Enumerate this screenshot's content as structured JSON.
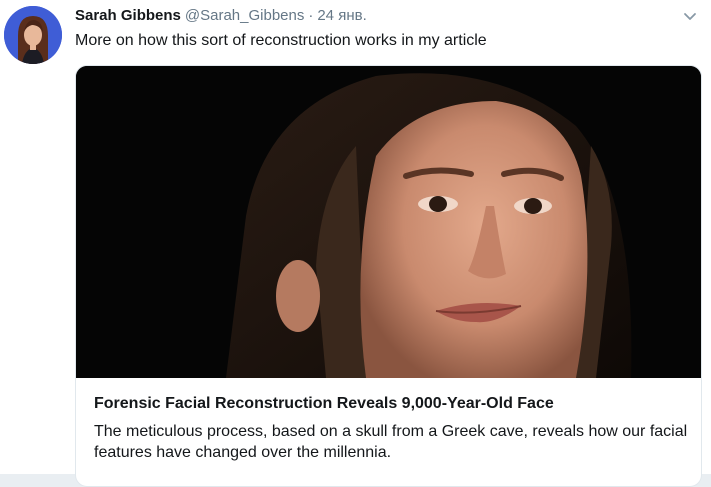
{
  "tweet": {
    "author_name": "Sarah Gibbens",
    "author_handle": "@Sarah_Gibbens",
    "separator": "·",
    "timestamp": "24 янв.",
    "text": "More on how this sort of reconstruction works in my article"
  },
  "card": {
    "title": "Forensic Facial Reconstruction Reveals 9,000-Year-Old Face",
    "description": "The meticulous process, based on a skull from a Greek cave, reveals how our facial features have changed over the millennia."
  },
  "icons": {
    "caret": "chevron-down-icon",
    "avatar": "avatar-portrait"
  },
  "colors": {
    "text_primary": "#14171a",
    "text_secondary": "#657786",
    "avatar_bg": "#3f5dd6",
    "card_border": "#e1e8ed"
  }
}
